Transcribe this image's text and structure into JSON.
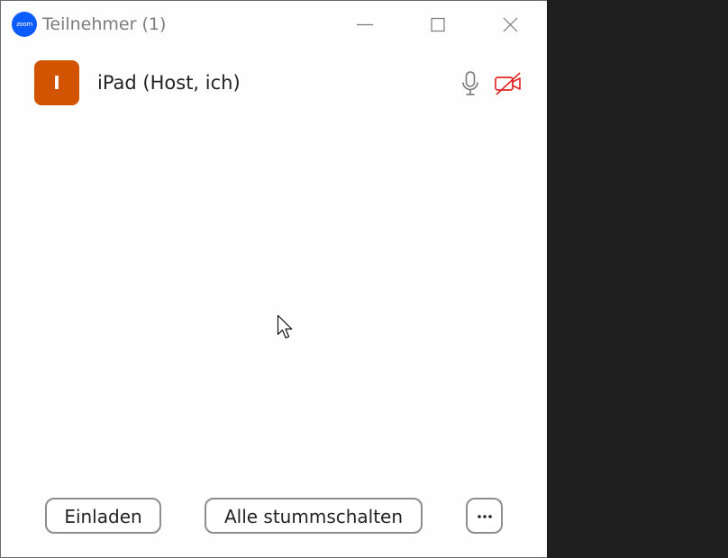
{
  "window": {
    "app_logo_text": "zoom",
    "title": "Teilnehmer (1)"
  },
  "participants": [
    {
      "initial": "I",
      "name": "iPad (Host, ich)",
      "avatar_color": "#d35400",
      "mic": "on",
      "video": "off"
    }
  ],
  "footer": {
    "invite_label": "Einladen",
    "mute_all_label": "Alle stummschalten",
    "more_icon": "more-horizontal-icon"
  },
  "colors": {
    "accent": "#0b5cff",
    "video_off": "#e02828",
    "window_bg": "#fffefe",
    "desktop_bg": "#1e1e1e"
  }
}
